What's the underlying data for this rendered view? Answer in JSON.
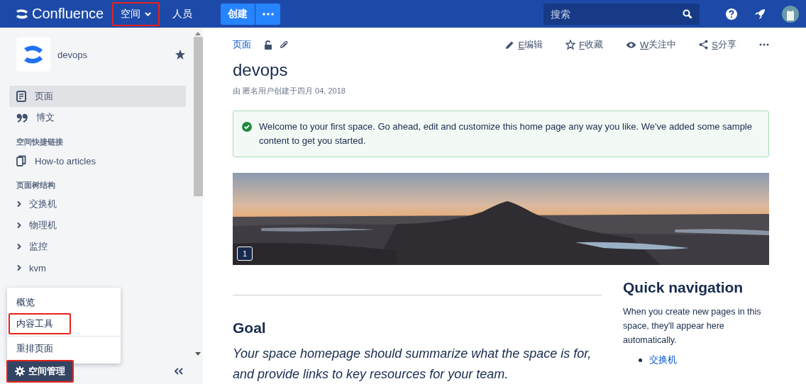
{
  "header": {
    "logo": "Confluence",
    "nav": [
      {
        "label": "空间",
        "dropdown": true,
        "highlighted": true
      },
      {
        "label": "人员",
        "dropdown": false,
        "highlighted": false
      }
    ],
    "create": "创建",
    "search": {
      "placeholder": "搜索"
    }
  },
  "sidebar": {
    "space_name": "devops",
    "starred": true,
    "items": [
      {
        "label": "页面",
        "kind": "pages",
        "selected": true
      },
      {
        "label": "博文",
        "kind": "blog",
        "selected": false
      }
    ],
    "shortcuts_title": "空间快捷链接",
    "shortcuts": [
      "How-to articles"
    ],
    "tree_title": "页面树结构",
    "tree": [
      {
        "label": "交换机",
        "expanded": false
      },
      {
        "label": "物理机",
        "expanded": false
      },
      {
        "label": "监控",
        "expanded": false
      },
      {
        "label": "kvm",
        "expanded": false
      }
    ],
    "menu": [
      {
        "label": "概览",
        "highlighted": false,
        "divider_after": false
      },
      {
        "label": "内容工具",
        "highlighted": true,
        "divider_after": true
      },
      {
        "label": "重排页面",
        "highlighted": false,
        "divider_after": false
      }
    ],
    "admin_button": {
      "label": "空间管理",
      "highlighted": true
    }
  },
  "page": {
    "breadcrumb": "页面",
    "actions": [
      {
        "kind": "edit",
        "key": "E",
        "label": "编辑"
      },
      {
        "kind": "star",
        "key": "F",
        "label": "收藏"
      },
      {
        "kind": "watch",
        "key": "W",
        "label": "关注中"
      },
      {
        "kind": "share",
        "key": "S",
        "label": "分享"
      }
    ],
    "title": "devops",
    "byline": "由 匿名用户创建于四月 04, 2018",
    "notice": "Welcome to your first space. Go ahead, edit and customize this home page any way you like. We've added some sample content to get you started.",
    "banner": {
      "kind": "picture",
      "comment_count": "1"
    },
    "goal_heading": "Goal",
    "goal_text": "Your space homepage should summarize what the space is for, and provide links to key resources for your team.",
    "quick_nav": {
      "heading": "Quick navigation",
      "text": "When you create new pages in this space, they'll appear here automatically.",
      "links": [
        "交换机"
      ]
    }
  }
}
